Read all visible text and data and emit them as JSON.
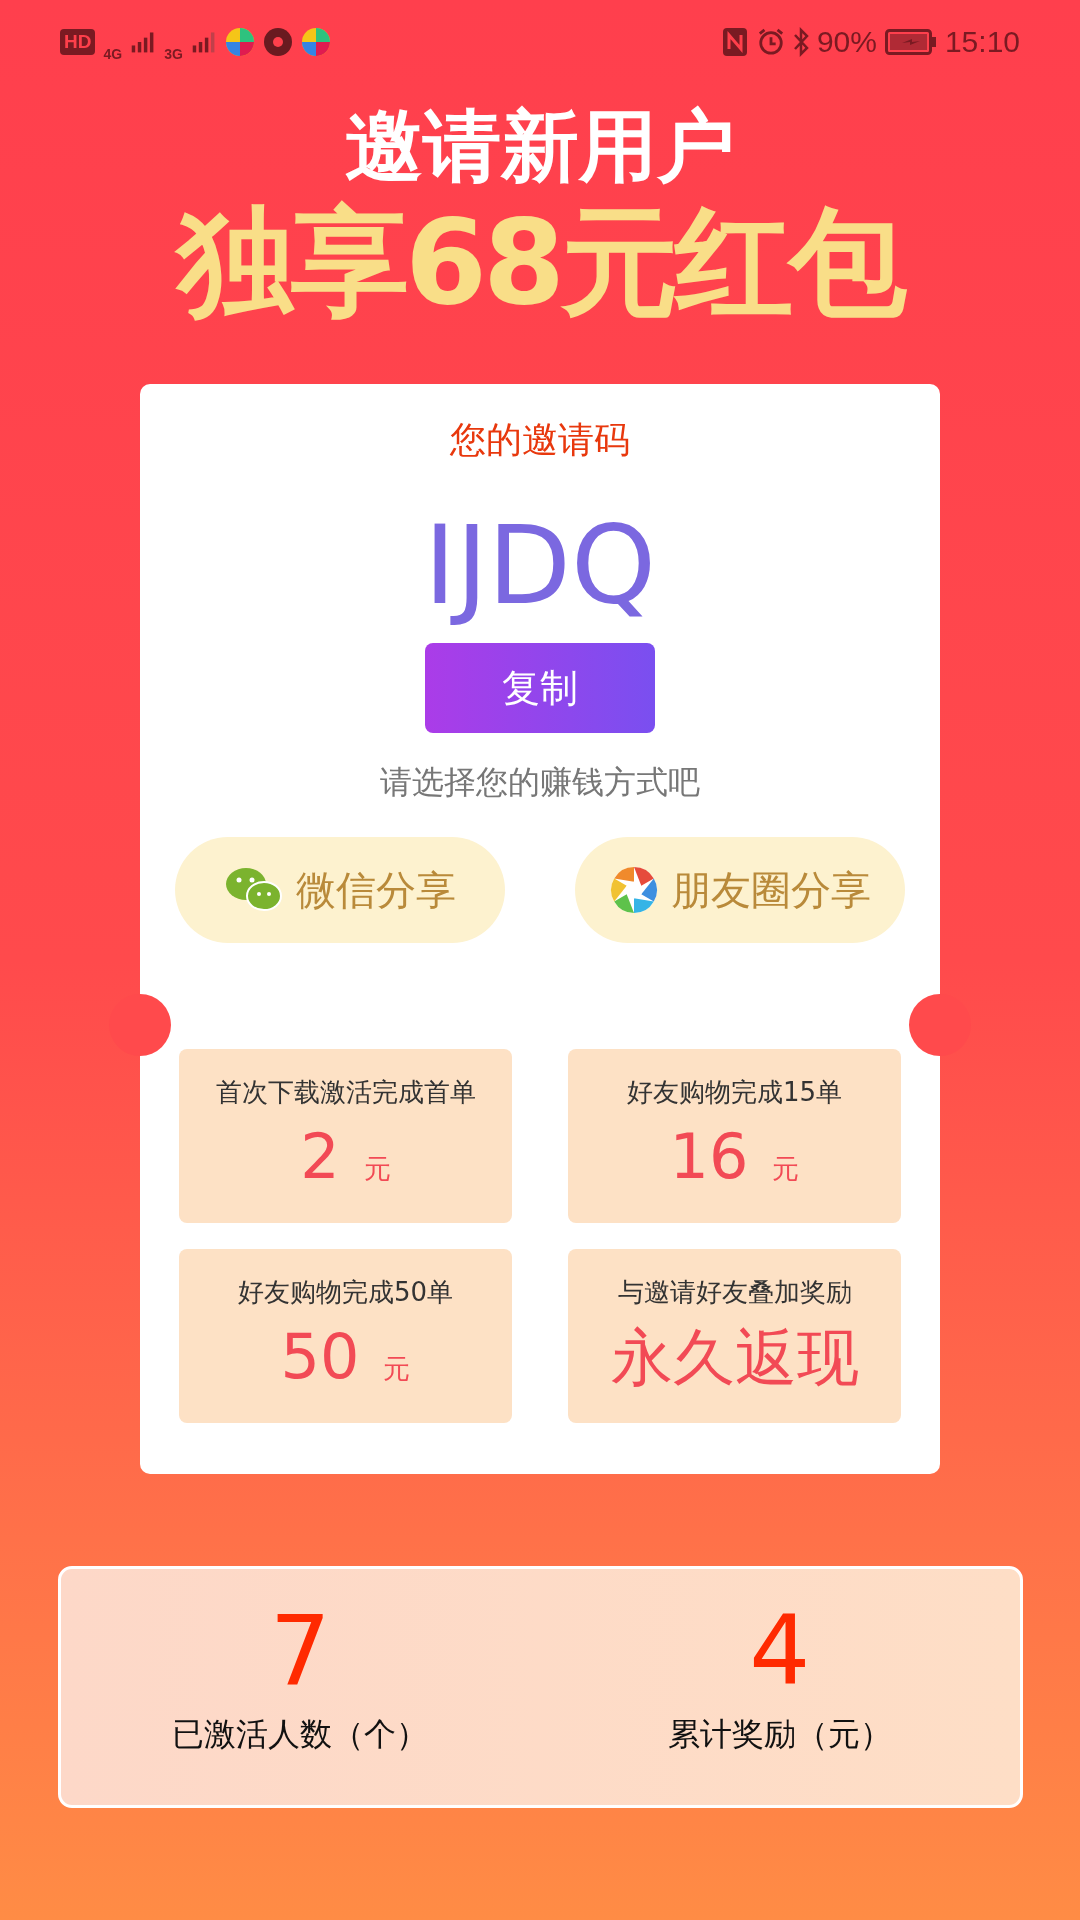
{
  "status_bar": {
    "left_badges": [
      "HD",
      "4G",
      "3G"
    ],
    "battery_percent": "90%",
    "time": "15:10"
  },
  "headline": "邀请新用户",
  "subheadline": "独享68元红包",
  "invite_card": {
    "title": "您的邀请码",
    "code": "IJDQ",
    "copy_button": "复制",
    "prompt": "请选择您的赚钱方式吧",
    "share_buttons": [
      {
        "kind": "wechat",
        "label": "微信分享"
      },
      {
        "kind": "moments",
        "label": "朋友圈分享"
      }
    ],
    "rewards": [
      {
        "kind": "amount",
        "label": "首次下载激活完成首单",
        "amount": "2",
        "unit": "元"
      },
      {
        "kind": "amount",
        "label": "好友购物完成15单",
        "amount": "16",
        "unit": "元"
      },
      {
        "kind": "amount",
        "label": "好友购物完成50单",
        "amount": "50",
        "unit": "元"
      },
      {
        "kind": "text",
        "label": "与邀请好友叠加奖励",
        "text": "永久返现"
      }
    ]
  },
  "stats": [
    {
      "value": "7",
      "label": "已激活人数（个）"
    },
    {
      "value": "4",
      "label": "累计奖励（元）"
    }
  ]
}
